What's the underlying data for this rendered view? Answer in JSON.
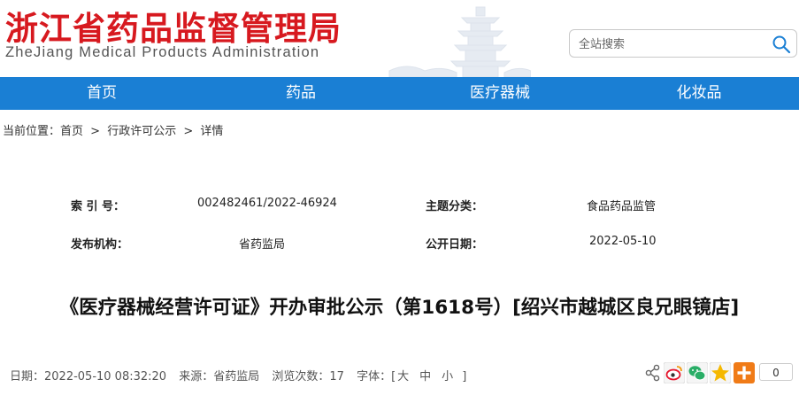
{
  "header": {
    "logo_cn": "浙江省药品监督管理局",
    "logo_en": "ZheJiang Medical Products Administration",
    "search_placeholder": "全站搜索"
  },
  "nav": {
    "items": [
      "首页",
      "药品",
      "医疗器械",
      "化妆品"
    ]
  },
  "breadcrumb": {
    "prefix": "当前位置：",
    "items": [
      "首页",
      "行政许可公示",
      "详情"
    ],
    "separator": ">"
  },
  "meta": {
    "index_label": "索 引 号：",
    "index_value": "002482461/2022-46924",
    "topic_label": "主题分类：",
    "topic_value": "食品药品监管",
    "publisher_label": "发布机构：",
    "publisher_value": "省药监局",
    "date_label": "公开日期：",
    "date_value": "2022-05-10"
  },
  "article": {
    "title": "《医疗器械经营许可证》开办审批公示（第1618号）[绍兴市越城区良兄眼镜店]"
  },
  "info": {
    "date": "日期：2022-05-10 08:32:20",
    "source": "来源：省药监局",
    "views": "浏览次数：17",
    "font_prefix": "字体：[",
    "font_large": "大",
    "font_medium": "中",
    "font_small": "小",
    "font_suffix": "]"
  },
  "share": {
    "count": "0",
    "icons": [
      "share-icon",
      "weibo-icon",
      "wechat-icon",
      "qzone-icon",
      "more-icon"
    ]
  },
  "colors": {
    "brand_red": "#d7191f",
    "nav_blue": "#1a7fd4"
  }
}
